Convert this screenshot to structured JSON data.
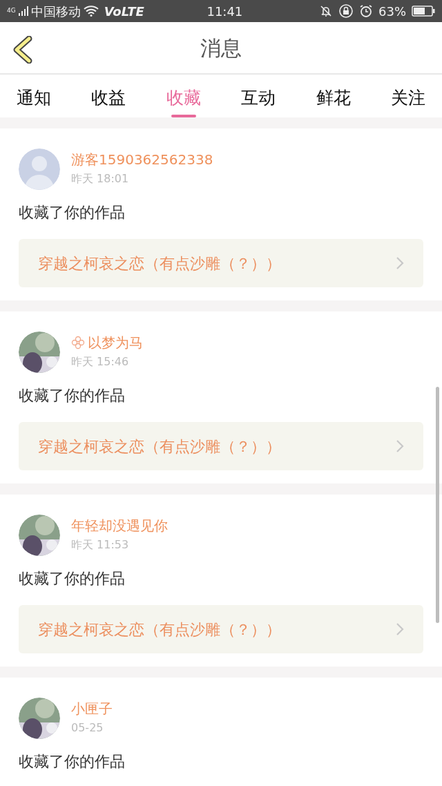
{
  "status_bar": {
    "network": "4G",
    "carrier": "中国移动",
    "volte": "VoLTE",
    "time": "11:41",
    "battery": "63%"
  },
  "header": {
    "title": "消息"
  },
  "tabs": [
    {
      "label": "通知",
      "selected": false
    },
    {
      "label": "收益",
      "selected": false
    },
    {
      "label": "收藏",
      "selected": true
    },
    {
      "label": "互动",
      "selected": false
    },
    {
      "label": "鲜花",
      "selected": false
    },
    {
      "label": "关注",
      "selected": false
    }
  ],
  "messages": [
    {
      "kind": "default",
      "user": "游客1590362562338",
      "badge": false,
      "time": "昨天 18:01",
      "text": "收藏了你的作品",
      "work": "穿越之柯哀之恋（有点沙雕（？））"
    },
    {
      "kind": "picture",
      "user": "以梦为马",
      "badge": true,
      "time": "昨天 15:46",
      "text": "收藏了你的作品",
      "work": "穿越之柯哀之恋（有点沙雕（？））"
    },
    {
      "kind": "picture",
      "user": "年轻却没遇见你",
      "badge": false,
      "time": "昨天 11:53",
      "text": "收藏了你的作品",
      "work": "穿越之柯哀之恋（有点沙雕（？））"
    },
    {
      "kind": "picture",
      "user": "小匣子",
      "badge": false,
      "time": "05-25",
      "text": "收藏了你的作品"
    }
  ]
}
